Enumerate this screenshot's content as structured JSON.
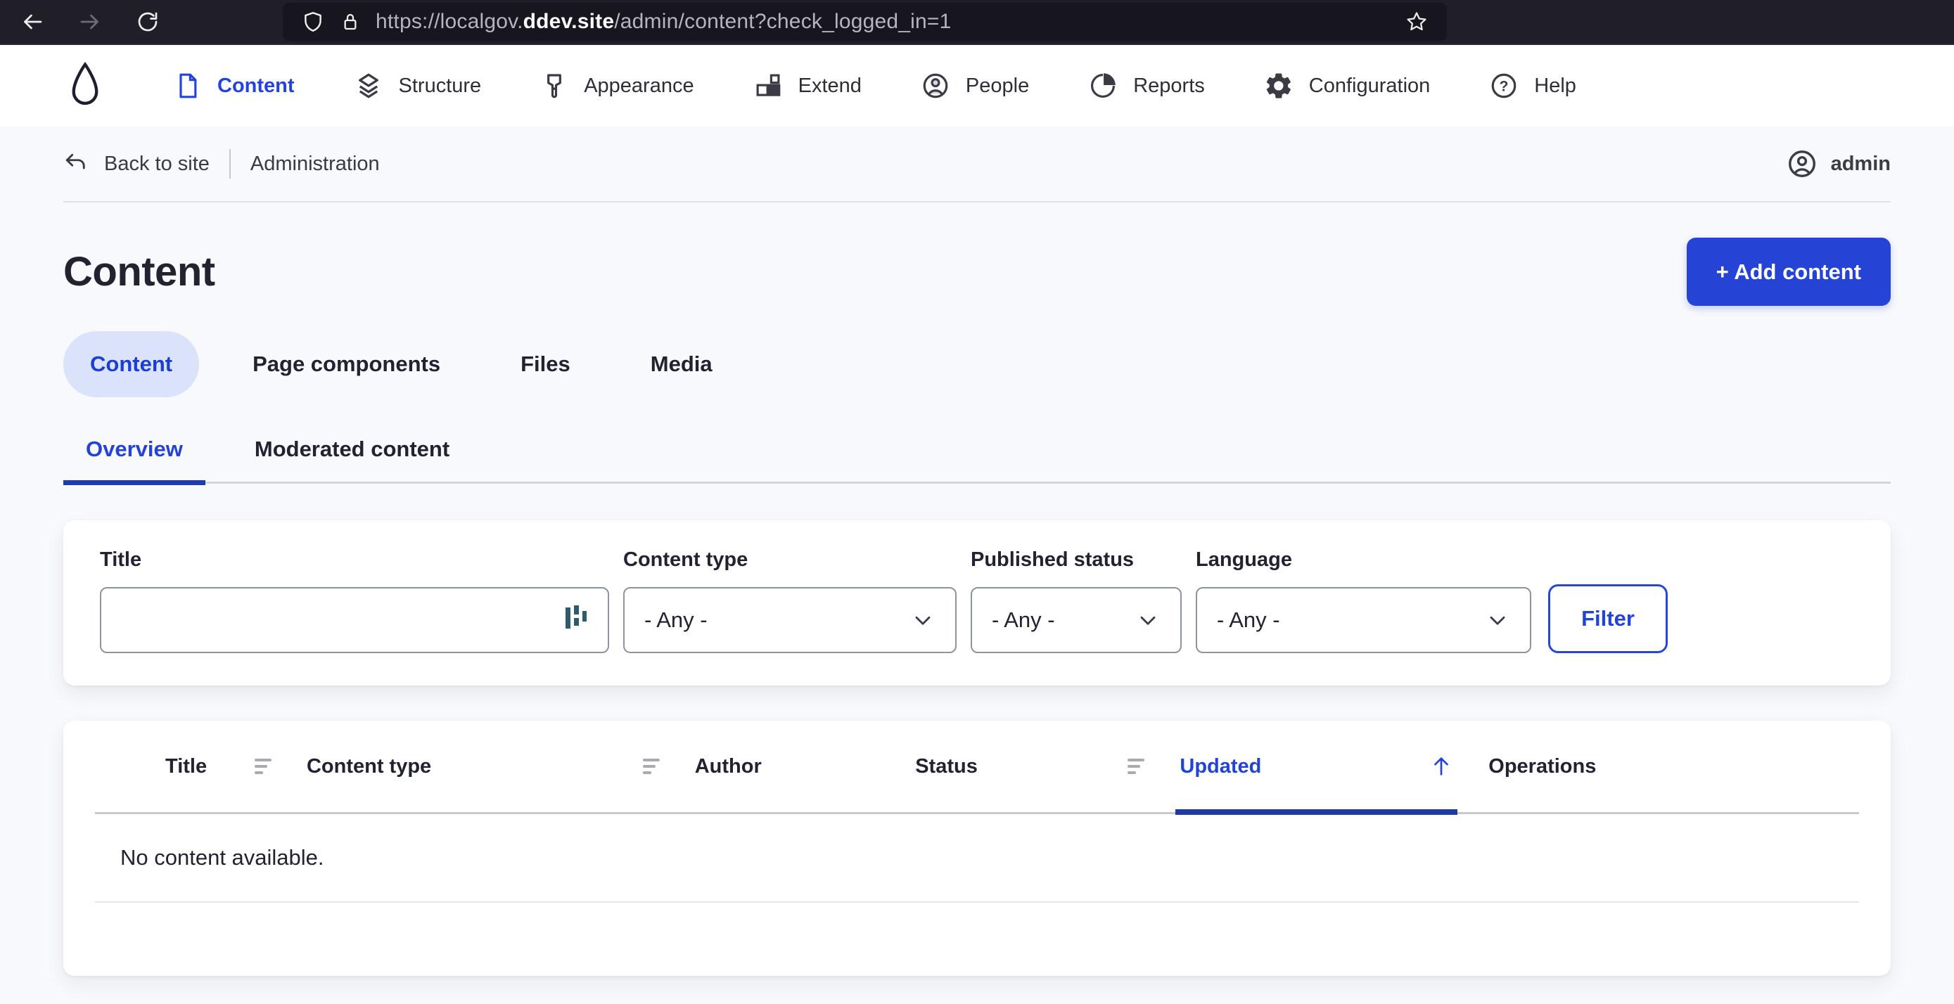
{
  "browser": {
    "url_prefix": "https://localgov.",
    "url_domain_bold": "ddev.site",
    "url_suffix": "/admin/content?check_logged_in=1"
  },
  "toolbar": {
    "items": [
      {
        "label": "Content",
        "active": true
      },
      {
        "label": "Structure",
        "active": false
      },
      {
        "label": "Appearance",
        "active": false
      },
      {
        "label": "Extend",
        "active": false
      },
      {
        "label": "People",
        "active": false
      },
      {
        "label": "Reports",
        "active": false
      },
      {
        "label": "Configuration",
        "active": false
      },
      {
        "label": "Help",
        "active": false
      }
    ]
  },
  "breadcrumb": {
    "back_to_site": "Back to site",
    "administration": "Administration",
    "user": "admin"
  },
  "page": {
    "title": "Content",
    "add_content_button": "+ Add content"
  },
  "tabs": {
    "primary": [
      {
        "label": "Content",
        "active": true
      },
      {
        "label": "Page components",
        "active": false
      },
      {
        "label": "Files",
        "active": false
      },
      {
        "label": "Media",
        "active": false
      }
    ],
    "secondary": [
      {
        "label": "Overview",
        "active": true
      },
      {
        "label": "Moderated content",
        "active": false
      }
    ]
  },
  "filters": {
    "title_label": "Title",
    "title_value": "",
    "content_type_label": "Content type",
    "published_status_label": "Published status",
    "language_label": "Language",
    "any_option": "- Any -",
    "filter_button": "Filter"
  },
  "table": {
    "headers": [
      "Title",
      "Content type",
      "Author",
      "Status",
      "Updated",
      "Operations"
    ],
    "sort_column": "Updated",
    "sort_direction": "ascending",
    "empty_message": "No content available."
  },
  "colors": {
    "accent_blue": "#2342d6",
    "button_blue": "#2543d4",
    "sort_underline_blue": "#1d3aa8",
    "active_pill_bg": "#dbe3fa",
    "page_bg": "#f8f9fc",
    "chrome_bg": "#201e26",
    "urlbar_bg": "#17151d",
    "text_dark": "#222331"
  }
}
